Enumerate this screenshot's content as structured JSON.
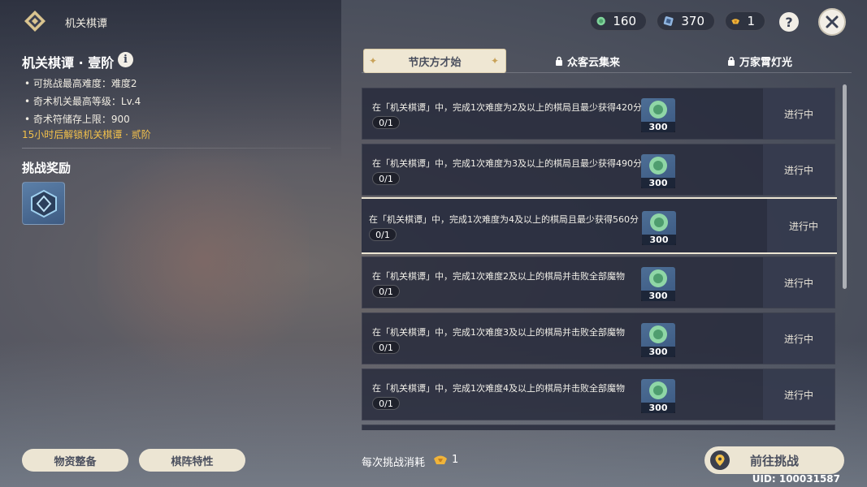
{
  "header": {
    "title": "机关棋谭"
  },
  "resources": [
    {
      "icon": "green-gem-icon",
      "value": "160"
    },
    {
      "icon": "blue-cube-icon",
      "value": "370"
    },
    {
      "icon": "gold-coin-icon",
      "value": "1"
    }
  ],
  "left": {
    "stage_title": "机关棋谭 · 壹阶",
    "info": [
      "可挑战最高难度：难度2",
      "奇术机关最高等级：Lv.4",
      "奇术符储存上限：900"
    ],
    "unlock_hint": "15小时后解锁机关棋谭 · 贰阶",
    "reward_title": "挑战奖励"
  },
  "tabs": [
    {
      "label": "节庆方才始",
      "locked": false,
      "active": true
    },
    {
      "label": "众客云集来",
      "locked": true,
      "active": false
    },
    {
      "label": "万家霄灯光",
      "locked": true,
      "active": false
    }
  ],
  "tasks": [
    {
      "text": "在「机关棋谭」中，完成1次难度为2及以上的棋局且最少获得420分",
      "progress": "0/1",
      "reward_qty": "300",
      "status": "进行中"
    },
    {
      "text": "在「机关棋谭」中，完成1次难度为3及以上的棋局且最少获得490分",
      "progress": "0/1",
      "reward_qty": "300",
      "status": "进行中"
    },
    {
      "text": "在「机关棋谭」中，完成1次难度为4及以上的棋局且最少获得560分",
      "progress": "0/1",
      "reward_qty": "300",
      "status": "进行中"
    },
    {
      "text": "在「机关棋谭」中，完成1次难度2及以上的棋局并击败全部魔物",
      "progress": "0/1",
      "reward_qty": "300",
      "status": "进行中"
    },
    {
      "text": "在「机关棋谭」中，完成1次难度3及以上的棋局并击败全部魔物",
      "progress": "0/1",
      "reward_qty": "300",
      "status": "进行中"
    },
    {
      "text": "在「机关棋谭」中，完成1次难度4及以上的棋局并击败全部魔物",
      "progress": "0/1",
      "reward_qty": "300",
      "status": "进行中"
    }
  ],
  "bottom": {
    "supply_label": "物资整备",
    "trait_label": "棋阵特性",
    "cost_label": "每次挑战消耗",
    "cost_value": "1",
    "go_label": "前往挑战",
    "uid": "UID: 100031587"
  }
}
